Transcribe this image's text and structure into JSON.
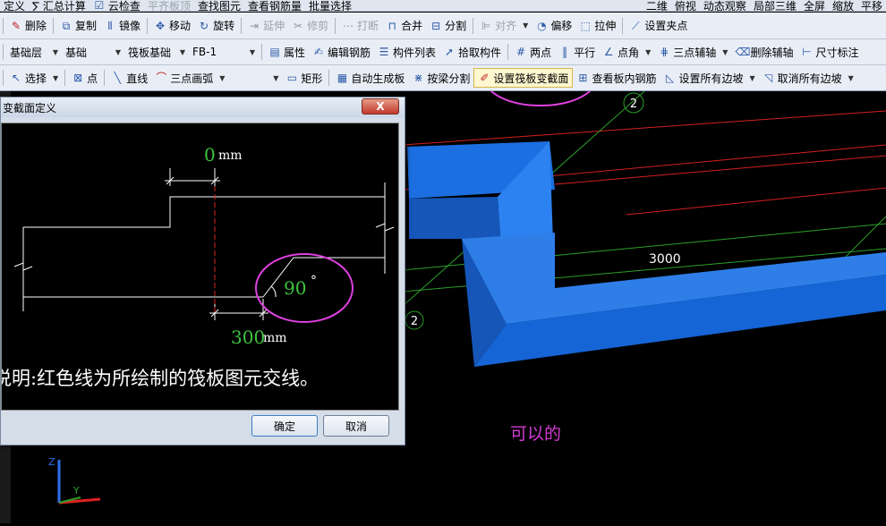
{
  "toolbar0": {
    "items": [
      "定义",
      "∑ 汇总计算",
      "云检查",
      "平齐板顶",
      "查找图元",
      "查看钢筋量",
      "批量选择",
      "二维",
      "俯视",
      "动态观察",
      "局部三维",
      "全屏",
      "缩放",
      "平移"
    ]
  },
  "toolbar1": {
    "delete": "删除",
    "copy": "复制",
    "mirror": "镜像",
    "move": "移动",
    "rotate": "旋转",
    "extend": "延伸",
    "trim": "修剪",
    "break": "打断",
    "merge": "合并",
    "split": "分割",
    "align": "对齐",
    "offset": "偏移",
    "stretch": "拉伸",
    "set_grip": "设置夹点"
  },
  "toolbar2": {
    "layer": "基础层",
    "category": "基础",
    "type": "筏板基础",
    "element": "FB-1",
    "properties": "属性",
    "edit_rebar": "编辑钢筋",
    "component_list": "构件列表",
    "pick_component": "拾取构件",
    "two_points": "两点",
    "parallel": "平行",
    "point_angle": "点角",
    "three_point_axis": "三点辅轴",
    "delete_axis": "删除辅轴",
    "dimension": "尺寸标注"
  },
  "toolbar3": {
    "select": "选择",
    "point": "点",
    "line": "直线",
    "arc": "三点画弧",
    "rect": "矩形",
    "auto_gen": "自动生成板",
    "by_beam": "按梁分割",
    "set_section_change": "设置筏板变截面",
    "view_rebar": "查看板内钢筋",
    "set_all_slopes": "设置所有边坡",
    "cancel_all_slopes": "取消所有边坡"
  },
  "viewport": {
    "dimension_label": "3000",
    "axis_label_top": "2",
    "axis_label_bottom": "2",
    "axis_z": "Z",
    "axis_y": "Y",
    "note": "可以的"
  },
  "dialog": {
    "title": "变截面定义",
    "close": "X",
    "dim_top_value": "0",
    "dim_top_unit": "mm",
    "angle_value": "90",
    "angle_unit": "°",
    "dim_bottom_value": "300",
    "dim_bottom_unit": "mm",
    "description": "说明:红色线为所绘制的筏板图元交线。",
    "ok": "确定",
    "cancel": "取消"
  },
  "colors": {
    "accent_circle": "#e040e0",
    "slab_blue": "#1c6fe0",
    "dim_green": "#3ec43e"
  }
}
